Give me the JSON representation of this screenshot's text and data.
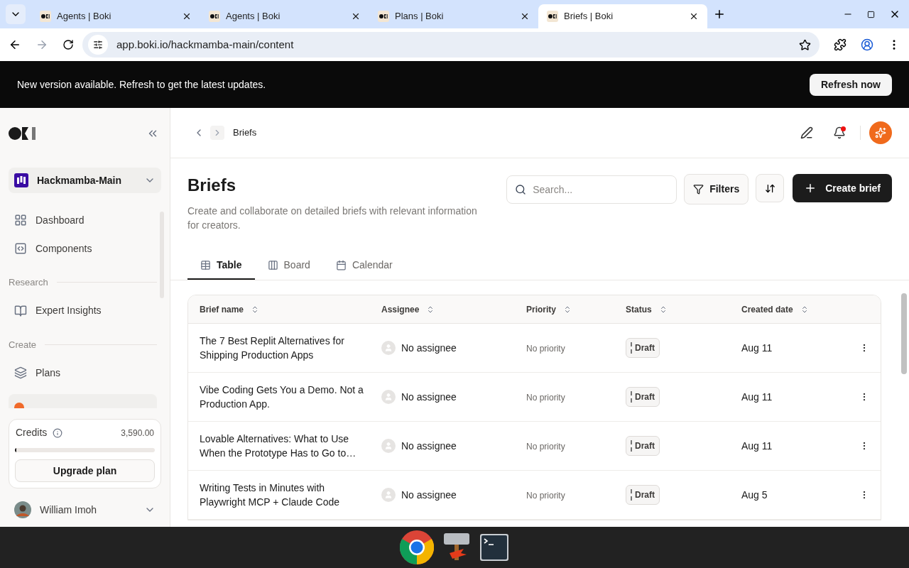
{
  "browser": {
    "tabs": [
      {
        "title": "Agents | Boki",
        "selected": false
      },
      {
        "title": "Agents | Boki",
        "selected": false
      },
      {
        "title": "Plans | Boki",
        "selected": false
      },
      {
        "title": "Briefs | Boki",
        "selected": true
      }
    ],
    "url": "app.boki.io/hackmamba-main/content"
  },
  "banner": {
    "message": "New version available. Refresh to get the latest updates.",
    "button": "Refresh now"
  },
  "sidebar": {
    "workspace": "Hackmamba-Main",
    "sections": [
      {
        "items": [
          {
            "label": "Dashboard"
          },
          {
            "label": "Components"
          }
        ]
      },
      {
        "heading": "Research",
        "items": [
          {
            "label": "Expert Insights"
          }
        ]
      },
      {
        "heading": "Create",
        "items": [
          {
            "label": "Plans"
          }
        ]
      }
    ],
    "credits": {
      "label": "Credits",
      "amount": "3,590.00",
      "level": 0.01,
      "button": "Upgrade plan"
    },
    "user": "William Imoh"
  },
  "breadcrumb": "Briefs",
  "page": {
    "title": "Briefs",
    "description": "Create and collaborate on detailed briefs with relevant information for creators.",
    "search_placeholder": "Search...",
    "filters": "Filters",
    "create": "Create brief"
  },
  "views": [
    {
      "label": "Table",
      "selected": true
    },
    {
      "label": "Board",
      "selected": false
    },
    {
      "label": "Calendar",
      "selected": false
    }
  ],
  "table": {
    "columns": [
      "Brief name",
      "Assignee",
      "Priority",
      "Status",
      "Created date"
    ],
    "rows": [
      {
        "name": "The 7 Best Replit Alternatives for Shipping Production Apps",
        "assignee": "No assignee",
        "priority": "No priority",
        "status": "Draft",
        "created": "Aug 11"
      },
      {
        "name": "Vibe Coding Gets You a Demo. Not a Production App.",
        "assignee": "No assignee",
        "priority": "No priority",
        "status": "Draft",
        "created": "Aug 11"
      },
      {
        "name": "Lovable Alternatives: What to Use When the Prototype Has to Go to…",
        "assignee": "No assignee",
        "priority": "No priority",
        "status": "Draft",
        "created": "Aug 11"
      },
      {
        "name": "Writing Tests in Minutes with Playwright MCP + Claude Code",
        "assignee": "No assignee",
        "priority": "No priority",
        "status": "Draft",
        "created": "Aug 5"
      }
    ]
  }
}
